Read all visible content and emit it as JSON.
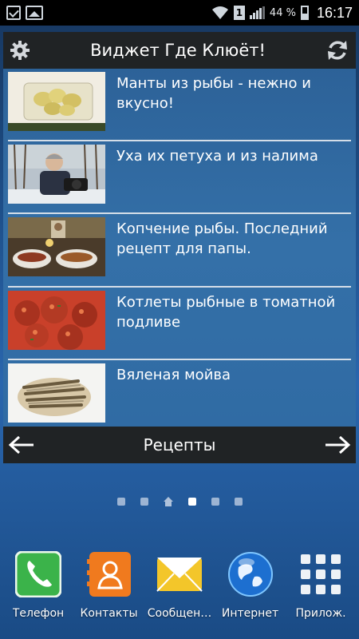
{
  "status_bar": {
    "battery_text": "44 %",
    "sim_badge": "1",
    "time": "16:17"
  },
  "widget": {
    "title": "Виджет Где Клюёт!",
    "items": [
      {
        "title": "Манты из рыбы - нежно и вкусно!"
      },
      {
        "title": "Уха их петуха и из налима"
      },
      {
        "title": "Копчение рыбы. Последний рецепт для папы."
      },
      {
        "title": "Котлеты рыбные в томатной подливе"
      },
      {
        "title": "Вяленая мойва"
      }
    ],
    "footer_title": "Рецепты"
  },
  "pager": {
    "count": 6,
    "home_index": 2,
    "active_index": 3
  },
  "dock": {
    "apps": [
      {
        "label": "Телефон",
        "icon": "phone-icon"
      },
      {
        "label": "Контакты",
        "icon": "contacts-icon"
      },
      {
        "label": "Сообщен…",
        "icon": "messages-icon"
      },
      {
        "label": "Интернет",
        "icon": "internet-icon"
      },
      {
        "label": "Прилож.",
        "icon": "apps-grid-icon"
      }
    ]
  }
}
